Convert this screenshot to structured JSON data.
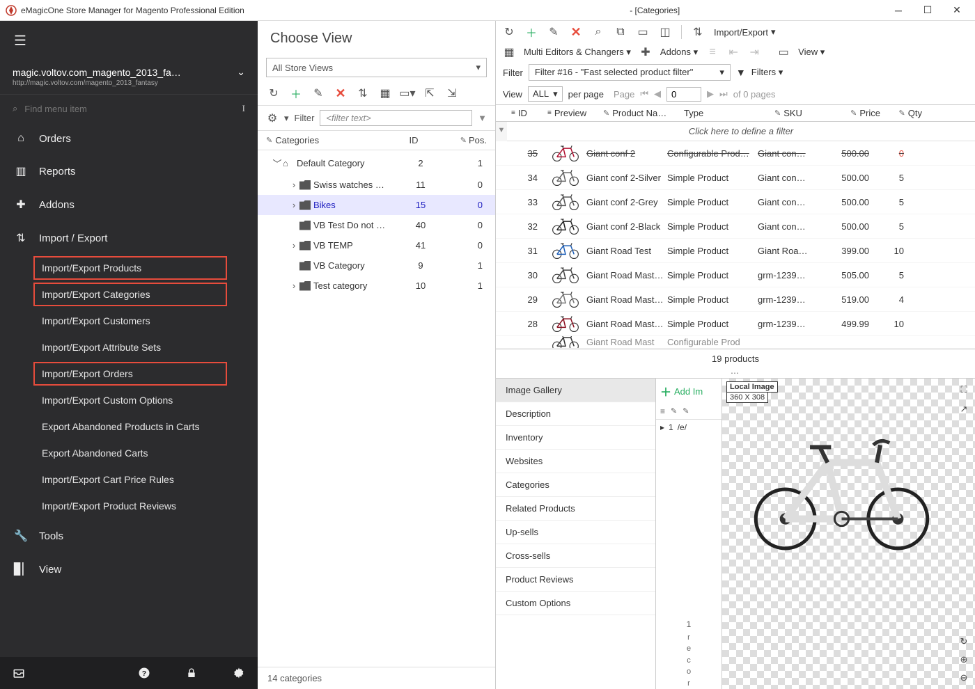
{
  "titleBar": {
    "appTitle": "eMagicOne Store Manager for Magento Professional Edition",
    "context": "- [Categories]"
  },
  "sidebar": {
    "storeName": "magic.voltov.com_magento_2013_fa…",
    "storeUrl": "http://magic.voltov.com/magento_2013_fantasy",
    "searchPlaceholder": "Find menu item",
    "nav": {
      "orders": "Orders",
      "reports": "Reports",
      "addons": "Addons",
      "importExport": "Import / Export",
      "tools": "Tools",
      "view": "View"
    },
    "subItems": {
      "products": "Import/Export Products",
      "categories": "Import/Export Categories",
      "customers": "Import/Export Customers",
      "attrSets": "Import/Export Attribute Sets",
      "orders": "Import/Export Orders",
      "customOpts": "Import/Export Custom Options",
      "abandonedProducts": "Export Abandoned Products in Carts",
      "abandonedCarts": "Export Abandoned Carts",
      "priceRules": "Import/Export Cart Price Rules",
      "reviews": "Import/Export Product Reviews"
    }
  },
  "centerPanel": {
    "heading": "Choose View",
    "storeSelect": "All Store Views",
    "filterLabel": "Filter",
    "filterPlaceholder": "<filter text>",
    "columns": {
      "categories": "Categories",
      "id": "ID",
      "pos": "Pos."
    },
    "tree": [
      {
        "label": "Default Category",
        "id": "2",
        "pos": "1",
        "level": 0,
        "twisty": "﹀",
        "home": true
      },
      {
        "label": "Swiss watches …",
        "id": "11",
        "pos": "0",
        "level": 1,
        "twisty": "›"
      },
      {
        "label": "Bikes",
        "id": "15",
        "pos": "0",
        "level": 1,
        "twisty": "›",
        "selected": true
      },
      {
        "label": "VB Test Do not …",
        "id": "40",
        "pos": "0",
        "level": 1,
        "twisty": ""
      },
      {
        "label": "VB TEMP",
        "id": "41",
        "pos": "0",
        "level": 1,
        "twisty": "›"
      },
      {
        "label": "VB Category",
        "id": "9",
        "pos": "1",
        "level": 1,
        "twisty": ""
      },
      {
        "label": "Test category",
        "id": "10",
        "pos": "1",
        "level": 1,
        "twisty": "›"
      }
    ],
    "footer": "14 categories"
  },
  "rightPanel": {
    "importExport": "Import/Export",
    "multiEditors": "Multi Editors & Changers",
    "addonsLabel": "Addons",
    "viewLabel": "View",
    "filterLabel": "Filter",
    "filterSelection": "Filter #16 - \"Fast selected product filter\"",
    "filtersBtn": "Filters",
    "viewRow": {
      "view": "View",
      "all": "ALL",
      "perPage": "per page",
      "page": "Page",
      "pageValue": "0",
      "ofPages": "of 0 pages"
    },
    "gridColumns": {
      "id": "ID",
      "preview": "Preview",
      "name": "Product Na…",
      "type": "Type",
      "sku": "SKU",
      "price": "Price",
      "qty": "Qty"
    },
    "filterDefine": "Click here to define a filter",
    "rows": [
      {
        "id": "35",
        "name": "Giant conf 2",
        "type": "Configurable Prod…",
        "sku": "Giant con…",
        "price": "500.00",
        "qty": "0",
        "strike": true,
        "color": "#b01030"
      },
      {
        "id": "34",
        "name": "Giant conf 2-Silver",
        "type": "Simple Product",
        "sku": "Giant con…",
        "price": "500.00",
        "qty": "5",
        "color": "#666"
      },
      {
        "id": "33",
        "name": "Giant conf 2-Grey",
        "type": "Simple Product",
        "sku": "Giant con…",
        "price": "500.00",
        "qty": "5",
        "color": "#555"
      },
      {
        "id": "32",
        "name": "Giant conf 2-Black",
        "type": "Simple Product",
        "sku": "Giant con…",
        "price": "500.00",
        "qty": "5",
        "color": "#222"
      },
      {
        "id": "31",
        "name": "Giant Road Test",
        "type": "Simple Product",
        "sku": "Giant Roa…",
        "price": "399.00",
        "qty": "10",
        "color": "#1e5fb8"
      },
      {
        "id": "30",
        "name": "Giant Road Mast…",
        "type": "Simple Product",
        "sku": "grm-1239…",
        "price": "505.00",
        "qty": "5",
        "color": "#444"
      },
      {
        "id": "29",
        "name": "Giant Road Mast…",
        "type": "Simple Product",
        "sku": "grm-1239…",
        "price": "519.00",
        "qty": "4",
        "color": "#777"
      },
      {
        "id": "28",
        "name": "Giant Road Mast…",
        "type": "Simple Product",
        "sku": "grm-1239…",
        "price": "499.99",
        "qty": "10",
        "color": "#8a1020"
      },
      {
        "id": "",
        "name": "Giant Road Mast",
        "type": "Configurable Prod",
        "sku": "",
        "price": "",
        "qty": "",
        "color": "#333",
        "partial": true
      }
    ],
    "gridStatus": "19 products",
    "tabs": [
      "Image Gallery",
      "Description",
      "Inventory",
      "Websites",
      "Categories",
      "Related Products",
      "Up-sells",
      "Cross-sells",
      "Product Reviews",
      "Custom Options"
    ],
    "addImage": "Add Im",
    "galleryRow": {
      "num": "1",
      "path": "/e/"
    },
    "previewLabel": "Local Image",
    "previewSize": "360 X 308",
    "misc": {
      "one": "1",
      "letters": [
        "r",
        "e",
        "c",
        "o",
        "r"
      ]
    }
  }
}
